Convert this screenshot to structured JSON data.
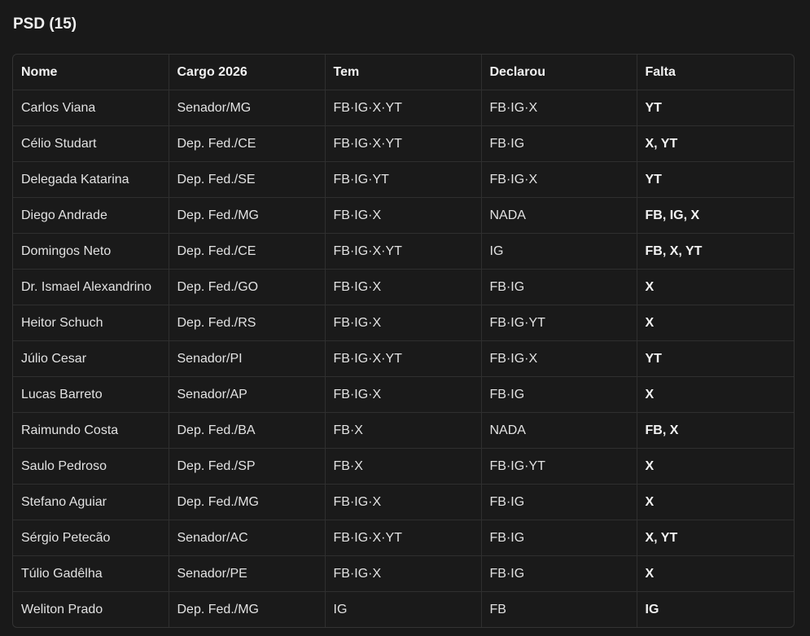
{
  "section": {
    "title": "PSD (15)"
  },
  "table": {
    "headers": [
      "Nome",
      "Cargo 2026",
      "Tem",
      "Declarou",
      "Falta"
    ],
    "rows": [
      [
        "Carlos Viana",
        "Senador/MG",
        "FB·IG·X·YT",
        "FB·IG·X",
        "YT"
      ],
      [
        "Célio Studart",
        "Dep. Fed./CE",
        "FB·IG·X·YT",
        "FB·IG",
        "X, YT"
      ],
      [
        "Delegada Katarina",
        "Dep. Fed./SE",
        "FB·IG·YT",
        "FB·IG·X",
        "YT"
      ],
      [
        "Diego Andrade",
        "Dep. Fed./MG",
        "FB·IG·X",
        "NADA",
        "FB, IG, X"
      ],
      [
        "Domingos Neto",
        "Dep. Fed./CE",
        "FB·IG·X·YT",
        "IG",
        "FB, X, YT"
      ],
      [
        "Dr. Ismael Alexandrino",
        "Dep. Fed./GO",
        "FB·IG·X",
        "FB·IG",
        "X"
      ],
      [
        "Heitor Schuch",
        "Dep. Fed./RS",
        "FB·IG·X",
        "FB·IG·YT",
        "X"
      ],
      [
        "Júlio Cesar",
        "Senador/PI",
        "FB·IG·X·YT",
        "FB·IG·X",
        "YT"
      ],
      [
        "Lucas Barreto",
        "Senador/AP",
        "FB·IG·X",
        "FB·IG",
        "X"
      ],
      [
        "Raimundo Costa",
        "Dep. Fed./BA",
        "FB·X",
        "NADA",
        "FB, X"
      ],
      [
        "Saulo Pedroso",
        "Dep. Fed./SP",
        "FB·X",
        "FB·IG·YT",
        "X"
      ],
      [
        "Stefano Aguiar",
        "Dep. Fed./MG",
        "FB·IG·X",
        "FB·IG",
        "X"
      ],
      [
        "Sérgio Petecão",
        "Senador/AC",
        "FB·IG·X·YT",
        "FB·IG",
        "X, YT"
      ],
      [
        "Túlio Gadêlha",
        "Senador/PE",
        "FB·IG·X",
        "FB·IG",
        "X"
      ],
      [
        "Weliton Prado",
        "Dep. Fed./MG",
        "IG",
        "FB",
        "IG"
      ]
    ]
  }
}
